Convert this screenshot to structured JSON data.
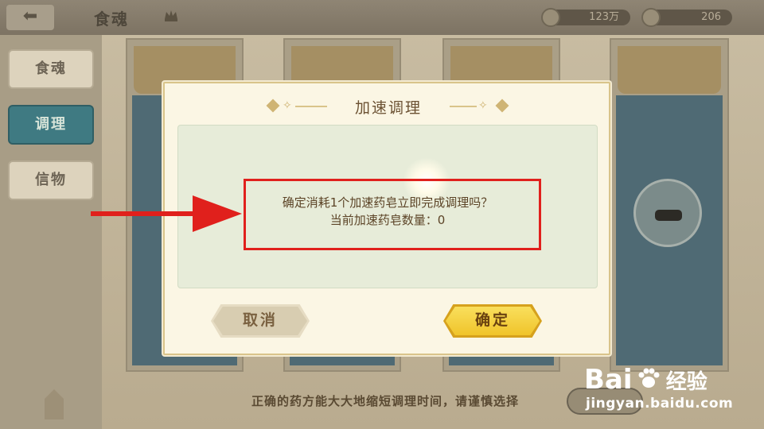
{
  "topbar": {
    "back_icon": "back-arrow-icon",
    "title": "食魂",
    "crown_icon": "crown-icon",
    "resource_1": {
      "icon": "quill-icon",
      "value": "123万"
    },
    "resource_2": {
      "icon": "coin-icon",
      "value": "206"
    }
  },
  "sidebar": {
    "tabs": [
      {
        "label": "食魂",
        "active": false
      },
      {
        "label": "调理",
        "active": true
      },
      {
        "label": "信物",
        "active": false
      }
    ]
  },
  "bottom": {
    "hint": "正确的药方能大大地缩短调理时间，请谨慎选择"
  },
  "dialog": {
    "title": "加速调理",
    "message_line1": "确定消耗1个加速药皂立即完成调理吗？",
    "message_line2": "当前加速药皂数量：0",
    "cancel_label": "取消",
    "confirm_label": "确定"
  },
  "watermark": {
    "logo_text": "Bai",
    "logo_text_2": "经验",
    "url": "jingyan.baidu.com"
  },
  "colors": {
    "annotation_red": "#e0201c",
    "confirm_gold": "#f0c42a",
    "active_tab_teal": "#3f7a82"
  }
}
